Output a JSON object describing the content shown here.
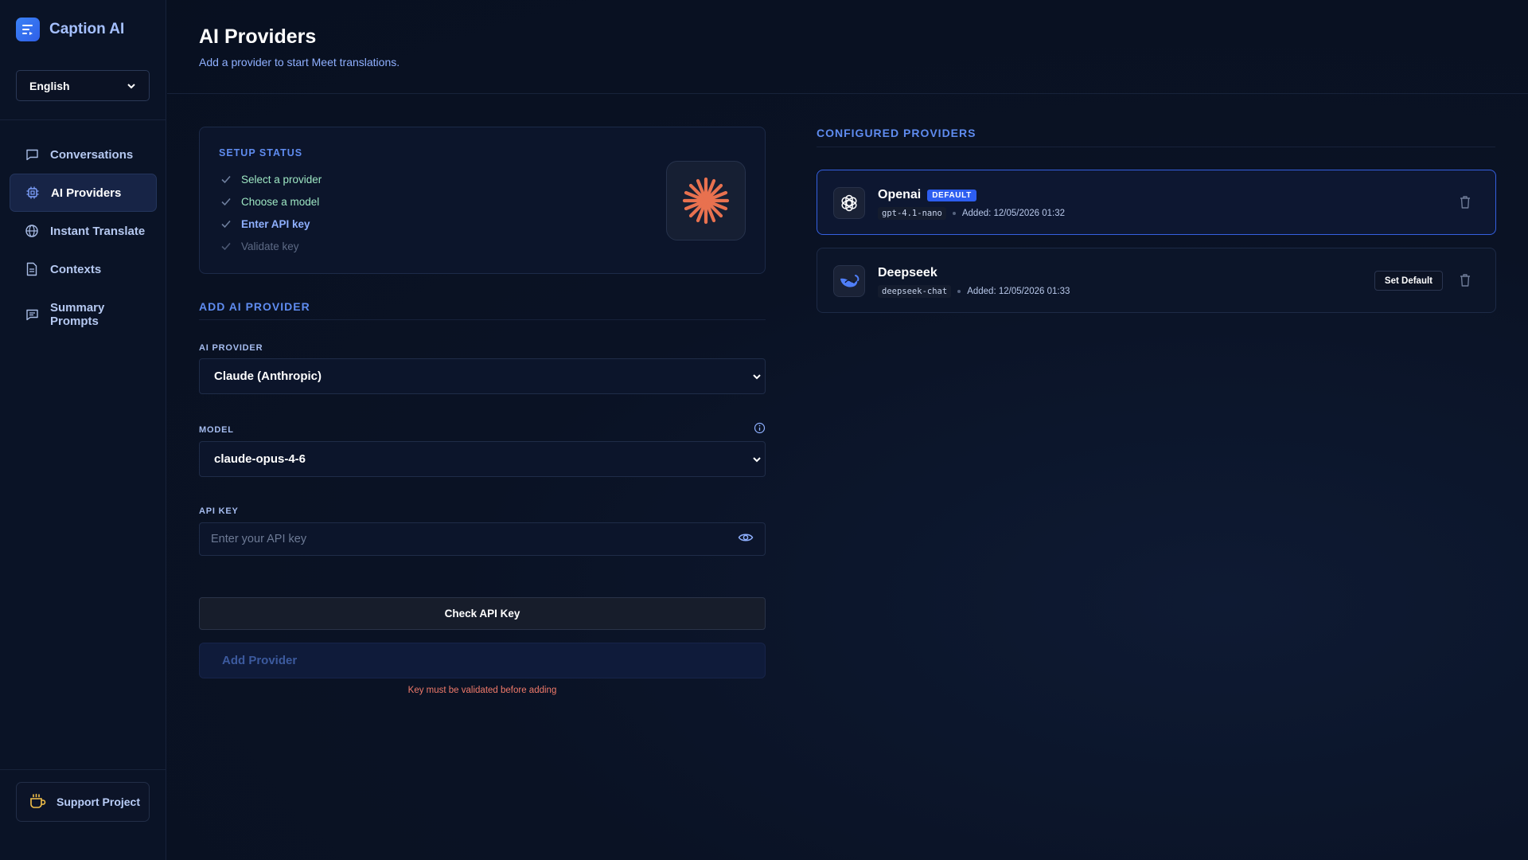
{
  "app": {
    "name": "Caption AI"
  },
  "language": {
    "selected": "English"
  },
  "sidebar": {
    "items": [
      {
        "label": "Conversations",
        "icon": "chat-bubble-icon",
        "active": false
      },
      {
        "label": "AI Providers",
        "icon": "cpu-chip-icon",
        "active": true
      },
      {
        "label": "Instant Translate",
        "icon": "globe-icon",
        "active": false
      },
      {
        "label": "Contexts",
        "icon": "document-icon",
        "active": false
      },
      {
        "label_line1": "Summary",
        "label_line2": "Prompts",
        "icon": "message-lines-icon",
        "active": false
      }
    ],
    "support_label": "Support Project"
  },
  "header": {
    "title": "AI Providers",
    "subtitle": "Add a provider to start Meet translations."
  },
  "setup": {
    "title": "SETUP STATUS",
    "steps": [
      {
        "label": "Select a provider",
        "state": "done"
      },
      {
        "label": "Choose a model",
        "state": "done"
      },
      {
        "label": "Enter API key",
        "state": "current"
      },
      {
        "label": "Validate key",
        "state": "pending"
      }
    ],
    "selected_provider_icon": "claude-starburst-icon"
  },
  "form": {
    "title": "ADD AI PROVIDER",
    "provider_label": "AI PROVIDER",
    "provider_value": "Claude (Anthropic)",
    "model_label": "MODEL",
    "model_value": "claude-opus-4-6",
    "api_key_label": "API KEY",
    "api_key_placeholder": "Enter your API key",
    "api_key_value": "",
    "check_label": "Check API Key",
    "add_label": "Add Provider",
    "hint": "Key must be validated before adding"
  },
  "configured": {
    "title": "CONFIGURED PROVIDERS",
    "providers": [
      {
        "name": "Openai",
        "is_default": true,
        "badge": "DEFAULT",
        "model": "gpt-4.1-nano",
        "added": "Added: 12/05/2026 01:32",
        "icon": "openai-logo-icon"
      },
      {
        "name": "Deepseek",
        "is_default": false,
        "model": "deepseek-chat",
        "added": "Added: 12/05/2026 01:33",
        "set_default_label": "Set Default",
        "icon": "deepseek-whale-icon"
      }
    ]
  },
  "colors": {
    "accent": "#5f8cf0",
    "default_badge": "#2d5ef0",
    "success": "#9ee7c3",
    "error": "#f07a6a",
    "claude": "#e8714f"
  }
}
